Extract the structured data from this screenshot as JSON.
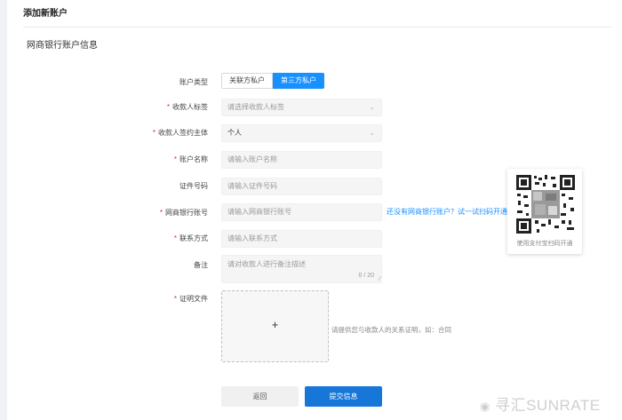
{
  "page": {
    "header": "添加新账户",
    "section_title": "网商银行账户信息"
  },
  "form": {
    "account_type": {
      "label": "账户类型",
      "options": [
        "关联方私户",
        "第三方私户"
      ],
      "selected": "第三方私户"
    },
    "payee_tag": {
      "label": "收款人标签",
      "required": true,
      "placeholder": "请选择收款人标签"
    },
    "payee_entity": {
      "label": "收款人签约主体",
      "required": true,
      "value": "个人"
    },
    "account_name": {
      "label": "账户名称",
      "required": true,
      "placeholder": "请输入账户名称"
    },
    "id_number": {
      "label": "证件号码",
      "required": false,
      "placeholder": "请输入证件号码"
    },
    "bank_account": {
      "label": "网商银行账号",
      "required": true,
      "placeholder": "请输入网商银行账号"
    },
    "contact": {
      "label": "联系方式",
      "required": true,
      "placeholder": "请输入联系方式"
    },
    "remark": {
      "label": "备注",
      "required": false,
      "placeholder": "请对收款人进行备注描述",
      "counter": "0 / 20"
    },
    "proof": {
      "label": "证明文件",
      "required": true,
      "hint": "请提供您与收款人的关系证明，如：合同"
    }
  },
  "no_account_link": "还没有网商银行账户？试一试扫码开通",
  "qr": {
    "caption": "使用支付宝扫码开通"
  },
  "buttons": {
    "back": "返回",
    "submit": "提交信息"
  },
  "watermark": "寻汇SUNRATE",
  "colors": {
    "primary": "#1890ff",
    "submit": "#1677d8",
    "required": "#f5222d"
  }
}
